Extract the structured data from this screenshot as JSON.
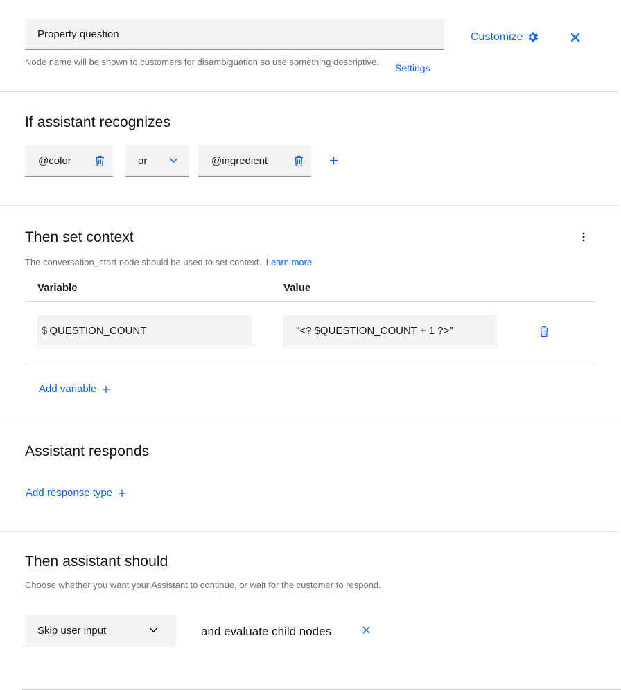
{
  "node": {
    "name_value": "Property question",
    "helper_text": "Node name will be shown to customers for disambiguation so use something descriptive.",
    "settings_label": "Settings",
    "customize_label": "Customize"
  },
  "condition": {
    "heading": "If assistant recognizes",
    "first_entity": "@color",
    "operator": "or",
    "second_entity": "@ingredient"
  },
  "context": {
    "heading": "Then set context",
    "helper_text": "The conversation_start node should be used to set context.",
    "learn_more_label": "Learn more",
    "col_variable": "Variable",
    "col_value": "Value",
    "rows": [
      {
        "prefix": "$",
        "variable": "QUESTION_COUNT",
        "value": "\"<? $QUESTION_COUNT + 1 ?>\""
      }
    ],
    "add_variable_label": "Add variable"
  },
  "responds": {
    "heading": "Assistant responds",
    "add_response_label": "Add response type"
  },
  "next_step": {
    "heading": "Then assistant should",
    "helper_text": "Choose whether you want your Assistant to continue, or wait for the customer to respond.",
    "action_value": "Skip user input",
    "followup_text": "and evaluate child nodes"
  },
  "colors": {
    "accent": "#0f62fe",
    "field_bg": "#f4f4f4",
    "divider": "#e0e0e0"
  }
}
